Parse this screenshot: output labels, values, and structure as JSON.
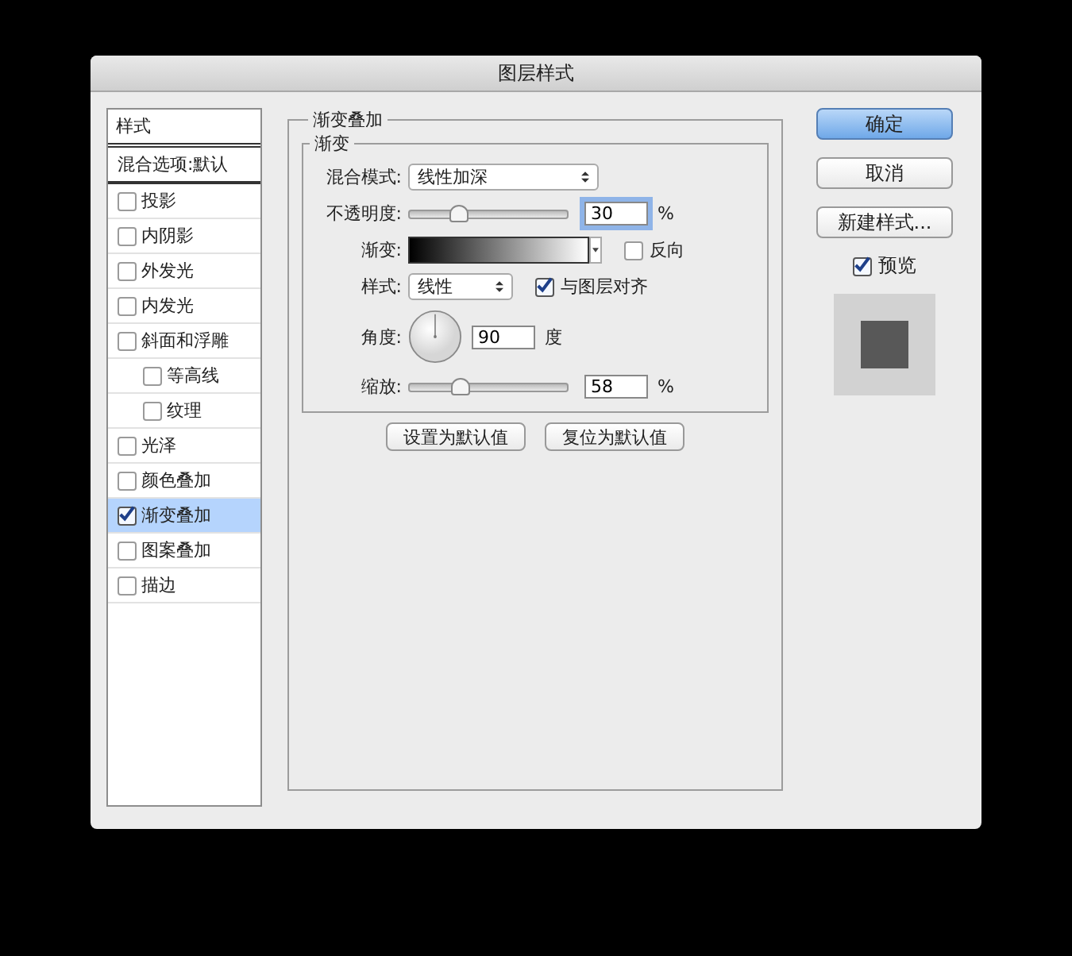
{
  "window": {
    "title": "图层样式"
  },
  "sidebar": {
    "header": "样式",
    "items": [
      {
        "kind": "plain",
        "label": "混合选项:默认",
        "selected": false
      },
      {
        "kind": "check",
        "label": "投影",
        "checked": false,
        "selected": false
      },
      {
        "kind": "check",
        "label": "内阴影",
        "checked": false,
        "selected": false
      },
      {
        "kind": "check",
        "label": "外发光",
        "checked": false,
        "selected": false
      },
      {
        "kind": "check",
        "label": "内发光",
        "checked": false,
        "selected": false
      },
      {
        "kind": "check",
        "label": "斜面和浮雕",
        "checked": false,
        "selected": false,
        "children": [
          {
            "kind": "check",
            "label": "等高线",
            "checked": false,
            "selected": false
          },
          {
            "kind": "check",
            "label": "纹理",
            "checked": false,
            "selected": false
          }
        ]
      },
      {
        "kind": "check",
        "label": "光泽",
        "checked": false,
        "selected": false
      },
      {
        "kind": "check",
        "label": "颜色叠加",
        "checked": false,
        "selected": false
      },
      {
        "kind": "check",
        "label": "渐变叠加",
        "checked": true,
        "selected": true
      },
      {
        "kind": "check",
        "label": "图案叠加",
        "checked": false,
        "selected": false
      },
      {
        "kind": "check",
        "label": "描边",
        "checked": false,
        "selected": false
      }
    ]
  },
  "panel": {
    "title": "渐变叠加",
    "group_title": "渐变",
    "blend_mode": {
      "label": "混合模式:",
      "value": "线性加深"
    },
    "opacity": {
      "label": "不透明度:",
      "level": 0.3,
      "value": "30",
      "unit": "%"
    },
    "gradient": {
      "label": "渐变:",
      "reverse": {
        "label": "反向",
        "checked": false
      }
    },
    "style": {
      "label": "样式:",
      "value": "线性",
      "align": {
        "label": "与图层对齐",
        "checked": true
      }
    },
    "angle": {
      "label": "角度:",
      "value": "90",
      "unit": "度"
    },
    "scale": {
      "label": "缩放:",
      "level": 0.31,
      "value": "58",
      "unit": "%"
    },
    "buttons": [
      "设置为默认值",
      "复位为默认值"
    ]
  },
  "actions": {
    "buttons": [
      {
        "label": "确定",
        "kind": "default"
      },
      {
        "label": "取消",
        "kind": "normal"
      },
      {
        "label": "新建样式...",
        "kind": "normal"
      }
    ],
    "preview": {
      "label": "预览",
      "checked": true
    }
  }
}
